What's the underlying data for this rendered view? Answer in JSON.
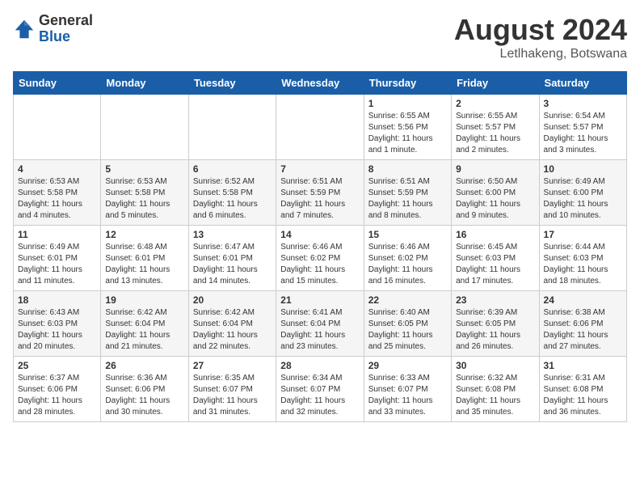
{
  "header": {
    "logo_general": "General",
    "logo_blue": "Blue",
    "main_title": "August 2024",
    "subtitle": "Letlhakeng, Botswana"
  },
  "calendar": {
    "days_of_week": [
      "Sunday",
      "Monday",
      "Tuesday",
      "Wednesday",
      "Thursday",
      "Friday",
      "Saturday"
    ],
    "weeks": [
      [
        {
          "day": "",
          "info": ""
        },
        {
          "day": "",
          "info": ""
        },
        {
          "day": "",
          "info": ""
        },
        {
          "day": "",
          "info": ""
        },
        {
          "day": "1",
          "info": "Sunrise: 6:55 AM\nSunset: 5:56 PM\nDaylight: 11 hours\nand 1 minute."
        },
        {
          "day": "2",
          "info": "Sunrise: 6:55 AM\nSunset: 5:57 PM\nDaylight: 11 hours\nand 2 minutes."
        },
        {
          "day": "3",
          "info": "Sunrise: 6:54 AM\nSunset: 5:57 PM\nDaylight: 11 hours\nand 3 minutes."
        }
      ],
      [
        {
          "day": "4",
          "info": "Sunrise: 6:53 AM\nSunset: 5:58 PM\nDaylight: 11 hours\nand 4 minutes."
        },
        {
          "day": "5",
          "info": "Sunrise: 6:53 AM\nSunset: 5:58 PM\nDaylight: 11 hours\nand 5 minutes."
        },
        {
          "day": "6",
          "info": "Sunrise: 6:52 AM\nSunset: 5:58 PM\nDaylight: 11 hours\nand 6 minutes."
        },
        {
          "day": "7",
          "info": "Sunrise: 6:51 AM\nSunset: 5:59 PM\nDaylight: 11 hours\nand 7 minutes."
        },
        {
          "day": "8",
          "info": "Sunrise: 6:51 AM\nSunset: 5:59 PM\nDaylight: 11 hours\nand 8 minutes."
        },
        {
          "day": "9",
          "info": "Sunrise: 6:50 AM\nSunset: 6:00 PM\nDaylight: 11 hours\nand 9 minutes."
        },
        {
          "day": "10",
          "info": "Sunrise: 6:49 AM\nSunset: 6:00 PM\nDaylight: 11 hours\nand 10 minutes."
        }
      ],
      [
        {
          "day": "11",
          "info": "Sunrise: 6:49 AM\nSunset: 6:01 PM\nDaylight: 11 hours\nand 11 minutes."
        },
        {
          "day": "12",
          "info": "Sunrise: 6:48 AM\nSunset: 6:01 PM\nDaylight: 11 hours\nand 13 minutes."
        },
        {
          "day": "13",
          "info": "Sunrise: 6:47 AM\nSunset: 6:01 PM\nDaylight: 11 hours\nand 14 minutes."
        },
        {
          "day": "14",
          "info": "Sunrise: 6:46 AM\nSunset: 6:02 PM\nDaylight: 11 hours\nand 15 minutes."
        },
        {
          "day": "15",
          "info": "Sunrise: 6:46 AM\nSunset: 6:02 PM\nDaylight: 11 hours\nand 16 minutes."
        },
        {
          "day": "16",
          "info": "Sunrise: 6:45 AM\nSunset: 6:03 PM\nDaylight: 11 hours\nand 17 minutes."
        },
        {
          "day": "17",
          "info": "Sunrise: 6:44 AM\nSunset: 6:03 PM\nDaylight: 11 hours\nand 18 minutes."
        }
      ],
      [
        {
          "day": "18",
          "info": "Sunrise: 6:43 AM\nSunset: 6:03 PM\nDaylight: 11 hours\nand 20 minutes."
        },
        {
          "day": "19",
          "info": "Sunrise: 6:42 AM\nSunset: 6:04 PM\nDaylight: 11 hours\nand 21 minutes."
        },
        {
          "day": "20",
          "info": "Sunrise: 6:42 AM\nSunset: 6:04 PM\nDaylight: 11 hours\nand 22 minutes."
        },
        {
          "day": "21",
          "info": "Sunrise: 6:41 AM\nSunset: 6:04 PM\nDaylight: 11 hours\nand 23 minutes."
        },
        {
          "day": "22",
          "info": "Sunrise: 6:40 AM\nSunset: 6:05 PM\nDaylight: 11 hours\nand 25 minutes."
        },
        {
          "day": "23",
          "info": "Sunrise: 6:39 AM\nSunset: 6:05 PM\nDaylight: 11 hours\nand 26 minutes."
        },
        {
          "day": "24",
          "info": "Sunrise: 6:38 AM\nSunset: 6:06 PM\nDaylight: 11 hours\nand 27 minutes."
        }
      ],
      [
        {
          "day": "25",
          "info": "Sunrise: 6:37 AM\nSunset: 6:06 PM\nDaylight: 11 hours\nand 28 minutes."
        },
        {
          "day": "26",
          "info": "Sunrise: 6:36 AM\nSunset: 6:06 PM\nDaylight: 11 hours\nand 30 minutes."
        },
        {
          "day": "27",
          "info": "Sunrise: 6:35 AM\nSunset: 6:07 PM\nDaylight: 11 hours\nand 31 minutes."
        },
        {
          "day": "28",
          "info": "Sunrise: 6:34 AM\nSunset: 6:07 PM\nDaylight: 11 hours\nand 32 minutes."
        },
        {
          "day": "29",
          "info": "Sunrise: 6:33 AM\nSunset: 6:07 PM\nDaylight: 11 hours\nand 33 minutes."
        },
        {
          "day": "30",
          "info": "Sunrise: 6:32 AM\nSunset: 6:08 PM\nDaylight: 11 hours\nand 35 minutes."
        },
        {
          "day": "31",
          "info": "Sunrise: 6:31 AM\nSunset: 6:08 PM\nDaylight: 11 hours\nand 36 minutes."
        }
      ]
    ]
  }
}
